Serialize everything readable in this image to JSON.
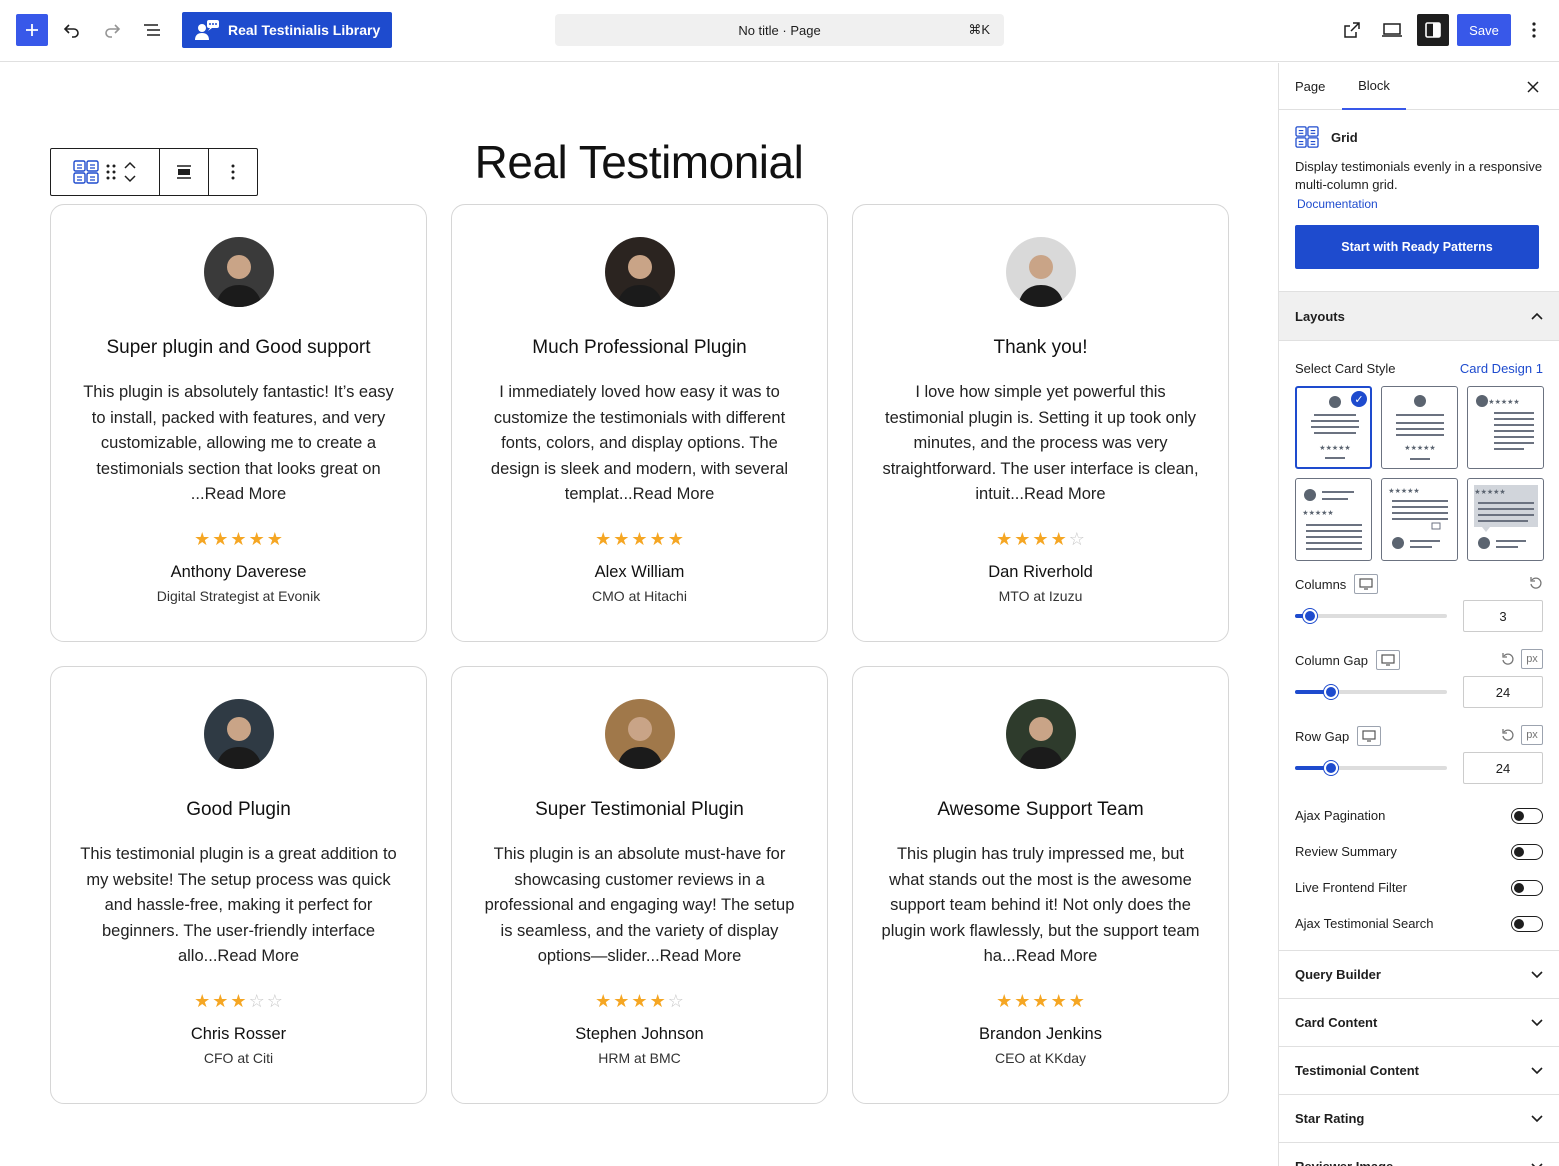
{
  "topbar": {
    "brand_label": "Real Testinialis Library",
    "doc_title": "No title · Page",
    "shortcut": "⌘K",
    "save_label": "Save"
  },
  "canvas": {
    "heading": "Real Testimonial"
  },
  "testimonials": [
    {
      "title": "Super plugin and Good support",
      "text": "This plugin is absolutely fantastic! It’s easy to install, packed with features, and very customizable, allowing me to create a testimonials section that looks great on ...",
      "read_more": "Read More",
      "rating": 5,
      "name": "Anthony Daverese",
      "role": "Digital Strategist at Evonik",
      "avatar_color": "#3a3a3a"
    },
    {
      "title": "Much Professional Plugin",
      "text": "I immediately loved how easy it was to customize the testimonials with different fonts, colors, and display options. The design is sleek and modern, with several templat...",
      "read_more": "Read More",
      "rating": 5,
      "name": "Alex William",
      "role": "CMO at Hitachi",
      "avatar_color": "#2b2420"
    },
    {
      "title": "Thank you!",
      "text": "I love how simple yet powerful this testimonial plugin is. Setting it up took only minutes, and the process was very straightforward. The user interface is clean, intuit...",
      "read_more": "Read More",
      "rating": 4,
      "name": "Dan Riverhold",
      "role": "MTO at Izuzu",
      "avatar_color": "#d9d9d9"
    },
    {
      "title": "Good Plugin",
      "text": "This testimonial plugin is a great addition to my website! The setup process was quick and hassle-free, making it perfect for beginners. The user-friendly interface allo...",
      "read_more": "Read More",
      "rating": 3,
      "name": "Chris Rosser",
      "role": "CFO at Citi",
      "avatar_color": "#2f3a44"
    },
    {
      "title": "Super Testimonial Plugin",
      "text": "This plugin is an absolute must-have for showcasing customer reviews in a professional and engaging way! The setup is seamless, and the variety of display options—slider...",
      "read_more": "Read More",
      "rating": 4,
      "name": "Stephen Johnson",
      "role": "HRM at BMC",
      "avatar_color": "#a0784a"
    },
    {
      "title": "Awesome Support Team",
      "text": "This plugin has truly impressed me, but what stands out the most is the awesome support team behind it! Not only does the plugin work flawlessly, but the support team ha...",
      "read_more": "Read More",
      "rating": 5,
      "name": "Brandon Jenkins",
      "role": "CEO at KKday",
      "avatar_color": "#2e3b2c"
    }
  ],
  "sidebar": {
    "tabs": {
      "page": "Page",
      "block": "Block"
    },
    "block": {
      "name": "Grid",
      "description": "Display testimonials evenly in a responsive multi-column grid.",
      "doc_link": "Documentation",
      "cta": "Start with Ready Patterns"
    },
    "layouts": {
      "title": "Layouts",
      "card_style_label": "Select Card Style",
      "card_style_value": "Card Design 1",
      "selected_style": 1,
      "columns_label": "Columns",
      "columns_value": "3",
      "columns_fraction": 0.1,
      "column_gap_label": "Column Gap",
      "column_gap_value": "24",
      "column_gap_fraction": 0.24,
      "column_gap_unit": "px",
      "row_gap_label": "Row Gap",
      "row_gap_value": "24",
      "row_gap_fraction": 0.24,
      "row_gap_unit": "px",
      "toggles": [
        {
          "label": "Ajax Pagination",
          "on": false
        },
        {
          "label": "Review Summary",
          "on": false
        },
        {
          "label": "Live Frontend Filter",
          "on": false
        },
        {
          "label": "Ajax Testimonial Search",
          "on": false
        }
      ]
    },
    "panels": [
      "Query Builder",
      "Card Content",
      "Testimonial Content",
      "Star Rating",
      "Reviewer Image"
    ]
  },
  "colors": {
    "accent": "#3858e9",
    "brand": "#1e4bce",
    "star": "#f5a623"
  }
}
